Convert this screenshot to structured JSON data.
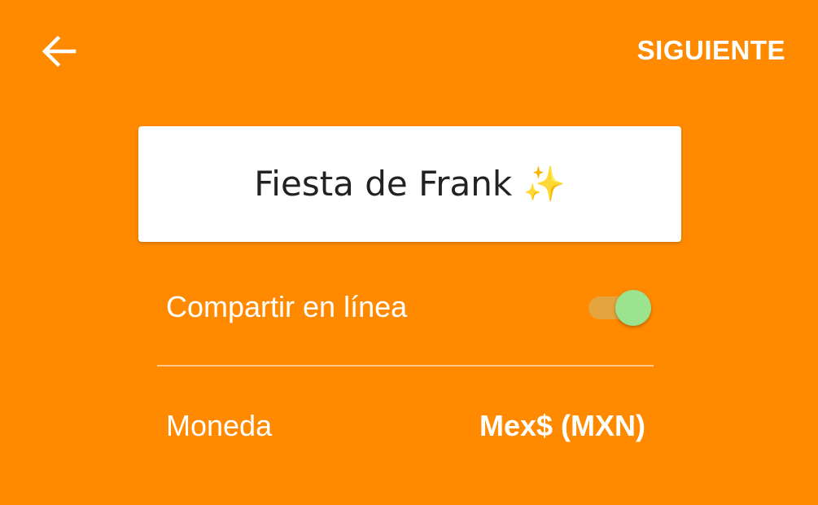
{
  "header": {
    "back_icon": "arrow-left-icon",
    "next_label": "SIGUIENTE"
  },
  "event": {
    "name_value": "Fiesta de Frank ✨"
  },
  "settings": {
    "share_online": {
      "label": "Compartir en línea",
      "enabled": true
    },
    "currency": {
      "label": "Moneda",
      "value": "Mex$ (MXN)"
    }
  },
  "colors": {
    "background": "#FF8A00",
    "card": "#FFFFFF",
    "toggle_thumb": "#9BE38E",
    "toggle_track": "#E4A43E"
  }
}
